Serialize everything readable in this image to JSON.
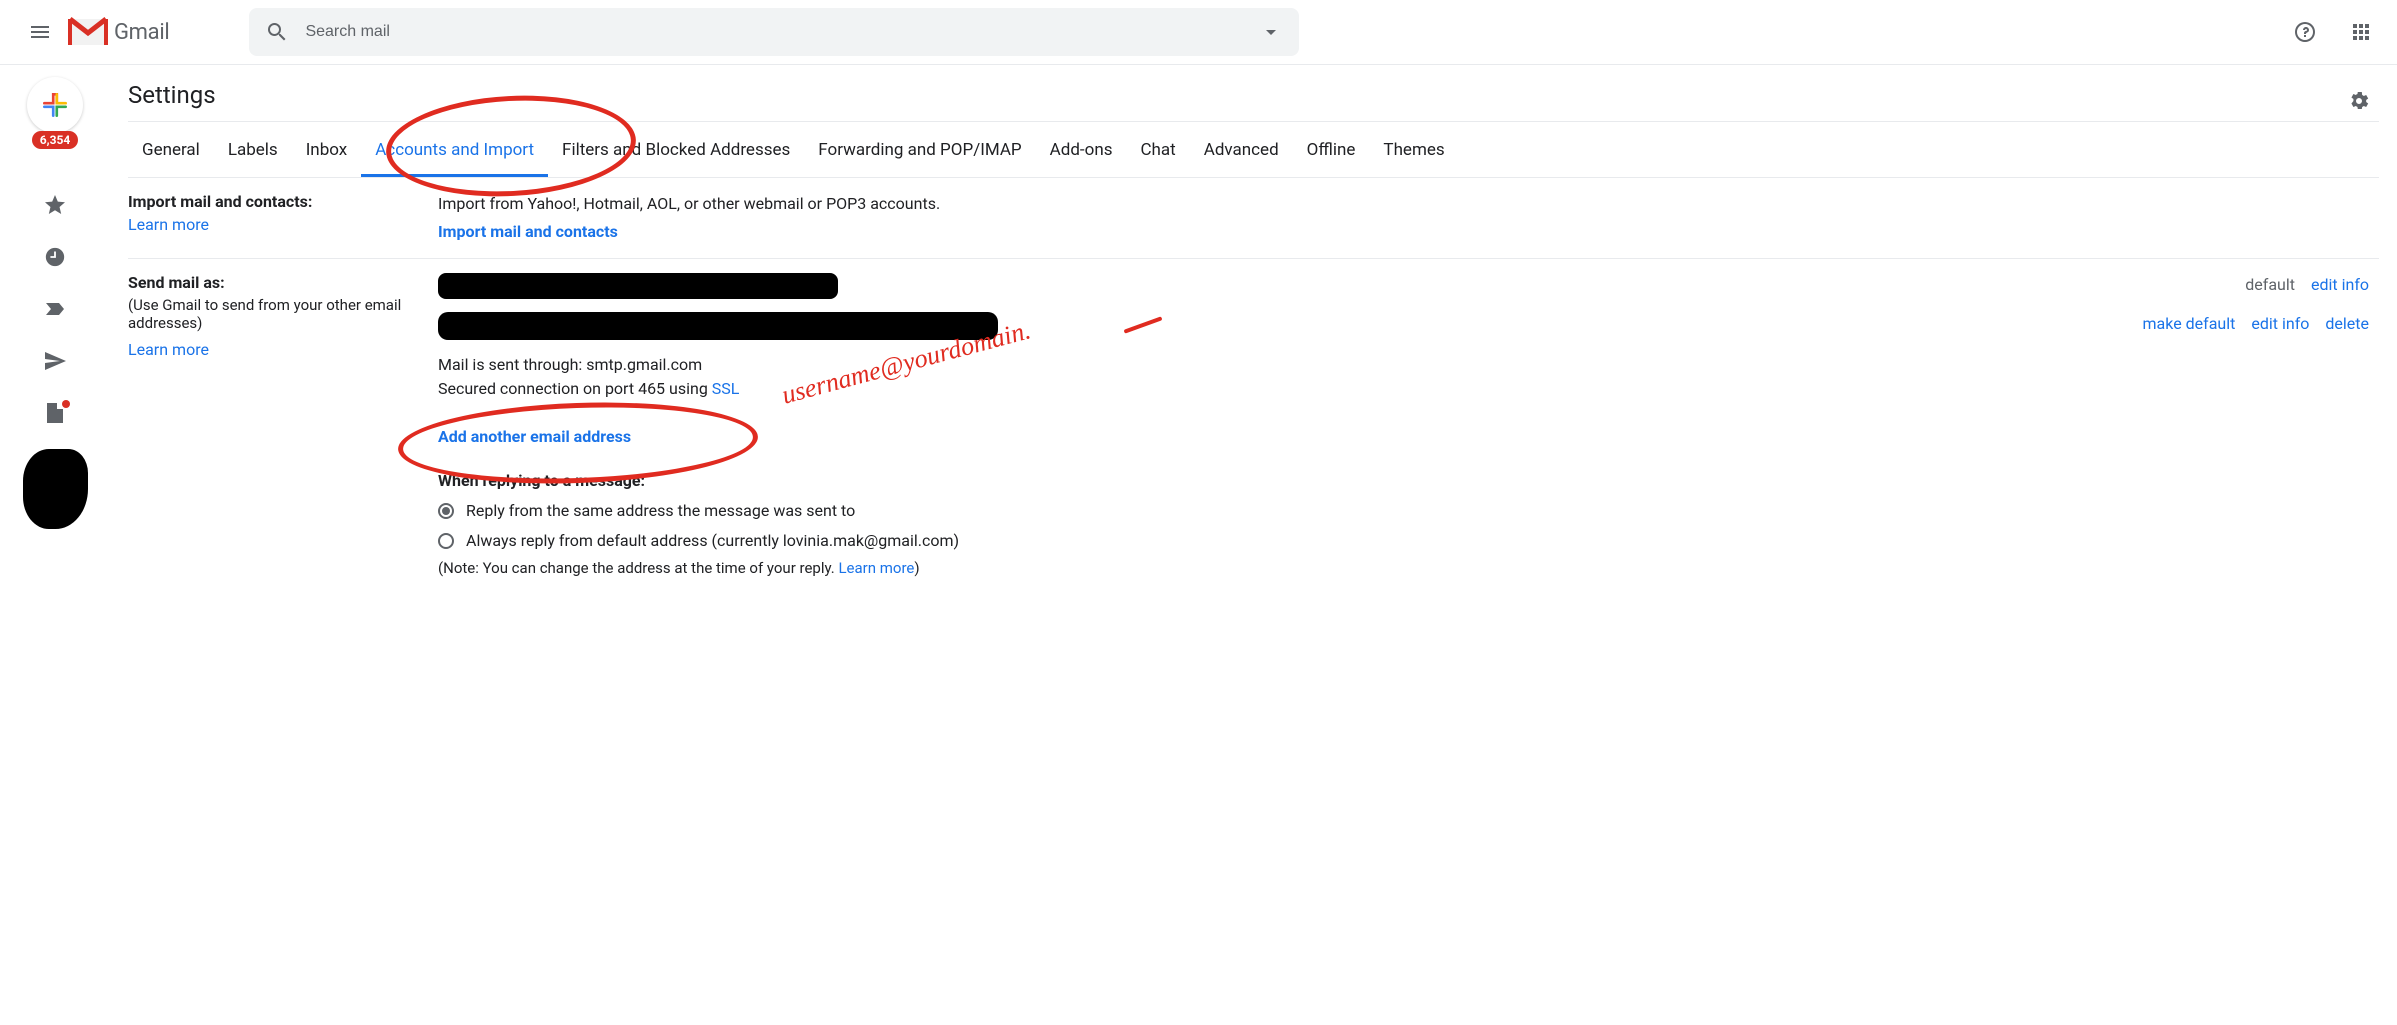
{
  "header": {
    "logo_text": "Gmail",
    "search_placeholder": "Search mail"
  },
  "sidebar": {
    "badge_count": "6,354"
  },
  "page": {
    "title": "Settings"
  },
  "tabs": [
    {
      "label": "General"
    },
    {
      "label": "Labels"
    },
    {
      "label": "Inbox"
    },
    {
      "label": "Accounts and Import"
    },
    {
      "label": "Filters and Blocked Addresses"
    },
    {
      "label": "Forwarding and POP/IMAP"
    },
    {
      "label": "Add-ons"
    },
    {
      "label": "Chat"
    },
    {
      "label": "Advanced"
    },
    {
      "label": "Offline"
    },
    {
      "label": "Themes"
    }
  ],
  "sections": {
    "import": {
      "label": "Import mail and contacts:",
      "learn_more": "Learn more",
      "desc": "Import from Yahoo!, Hotmail, AOL, or other webmail or POP3 accounts.",
      "action": "Import mail and contacts"
    },
    "send_as": {
      "label": "Send mail as:",
      "sub": "(Use Gmail to send from your other email addresses)",
      "learn_more": "Learn more",
      "row1": {
        "status": "default",
        "edit": "edit info"
      },
      "row2": {
        "mail_through": "Mail is sent through: smtp.gmail.com",
        "secured_a": "Secured connection on port 465 using ",
        "secured_b": "SSL",
        "make_default": "make default",
        "edit": "edit info",
        "delete": "delete"
      },
      "add_another": "Add another email address",
      "reply_heading": "When replying to a message:",
      "reply_opt1": "Reply from the same address the message was sent to",
      "reply_opt2": "Always reply from default address (currently lovinia.mak@gmail.com)",
      "note_a": "(Note: You can change the address at the time of your reply. ",
      "note_b": "Learn more",
      "note_c": ")"
    }
  },
  "annotation": {
    "handwriting": "username@yourdomain."
  }
}
